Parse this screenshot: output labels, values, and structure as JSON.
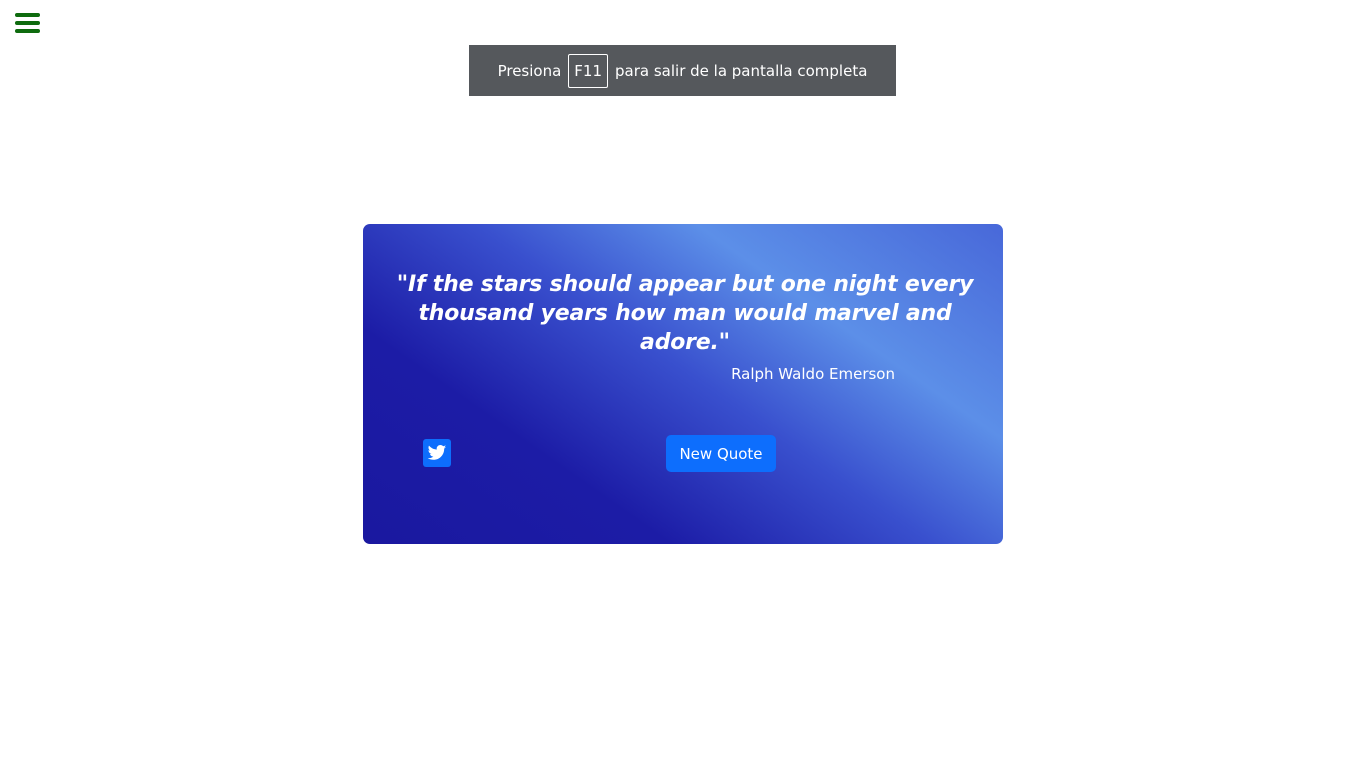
{
  "menu": {
    "icon": "hamburger-menu-icon",
    "color": "#0e6b0e"
  },
  "fullscreen_notice": {
    "prefix": "Presiona",
    "key": "F11",
    "suffix": "para salir de la pantalla completa"
  },
  "quote_box": {
    "text": "\"If the stars should appear but one night every thousand years how man would marvel and adore.\"",
    "author": "Ralph Waldo Emerson",
    "tweet_icon": "twitter-icon",
    "new_quote_label": "New Quote",
    "button_color": "#0d6efd",
    "gradient_colors": [
      "#1a189f",
      "#5c8fe8"
    ]
  }
}
